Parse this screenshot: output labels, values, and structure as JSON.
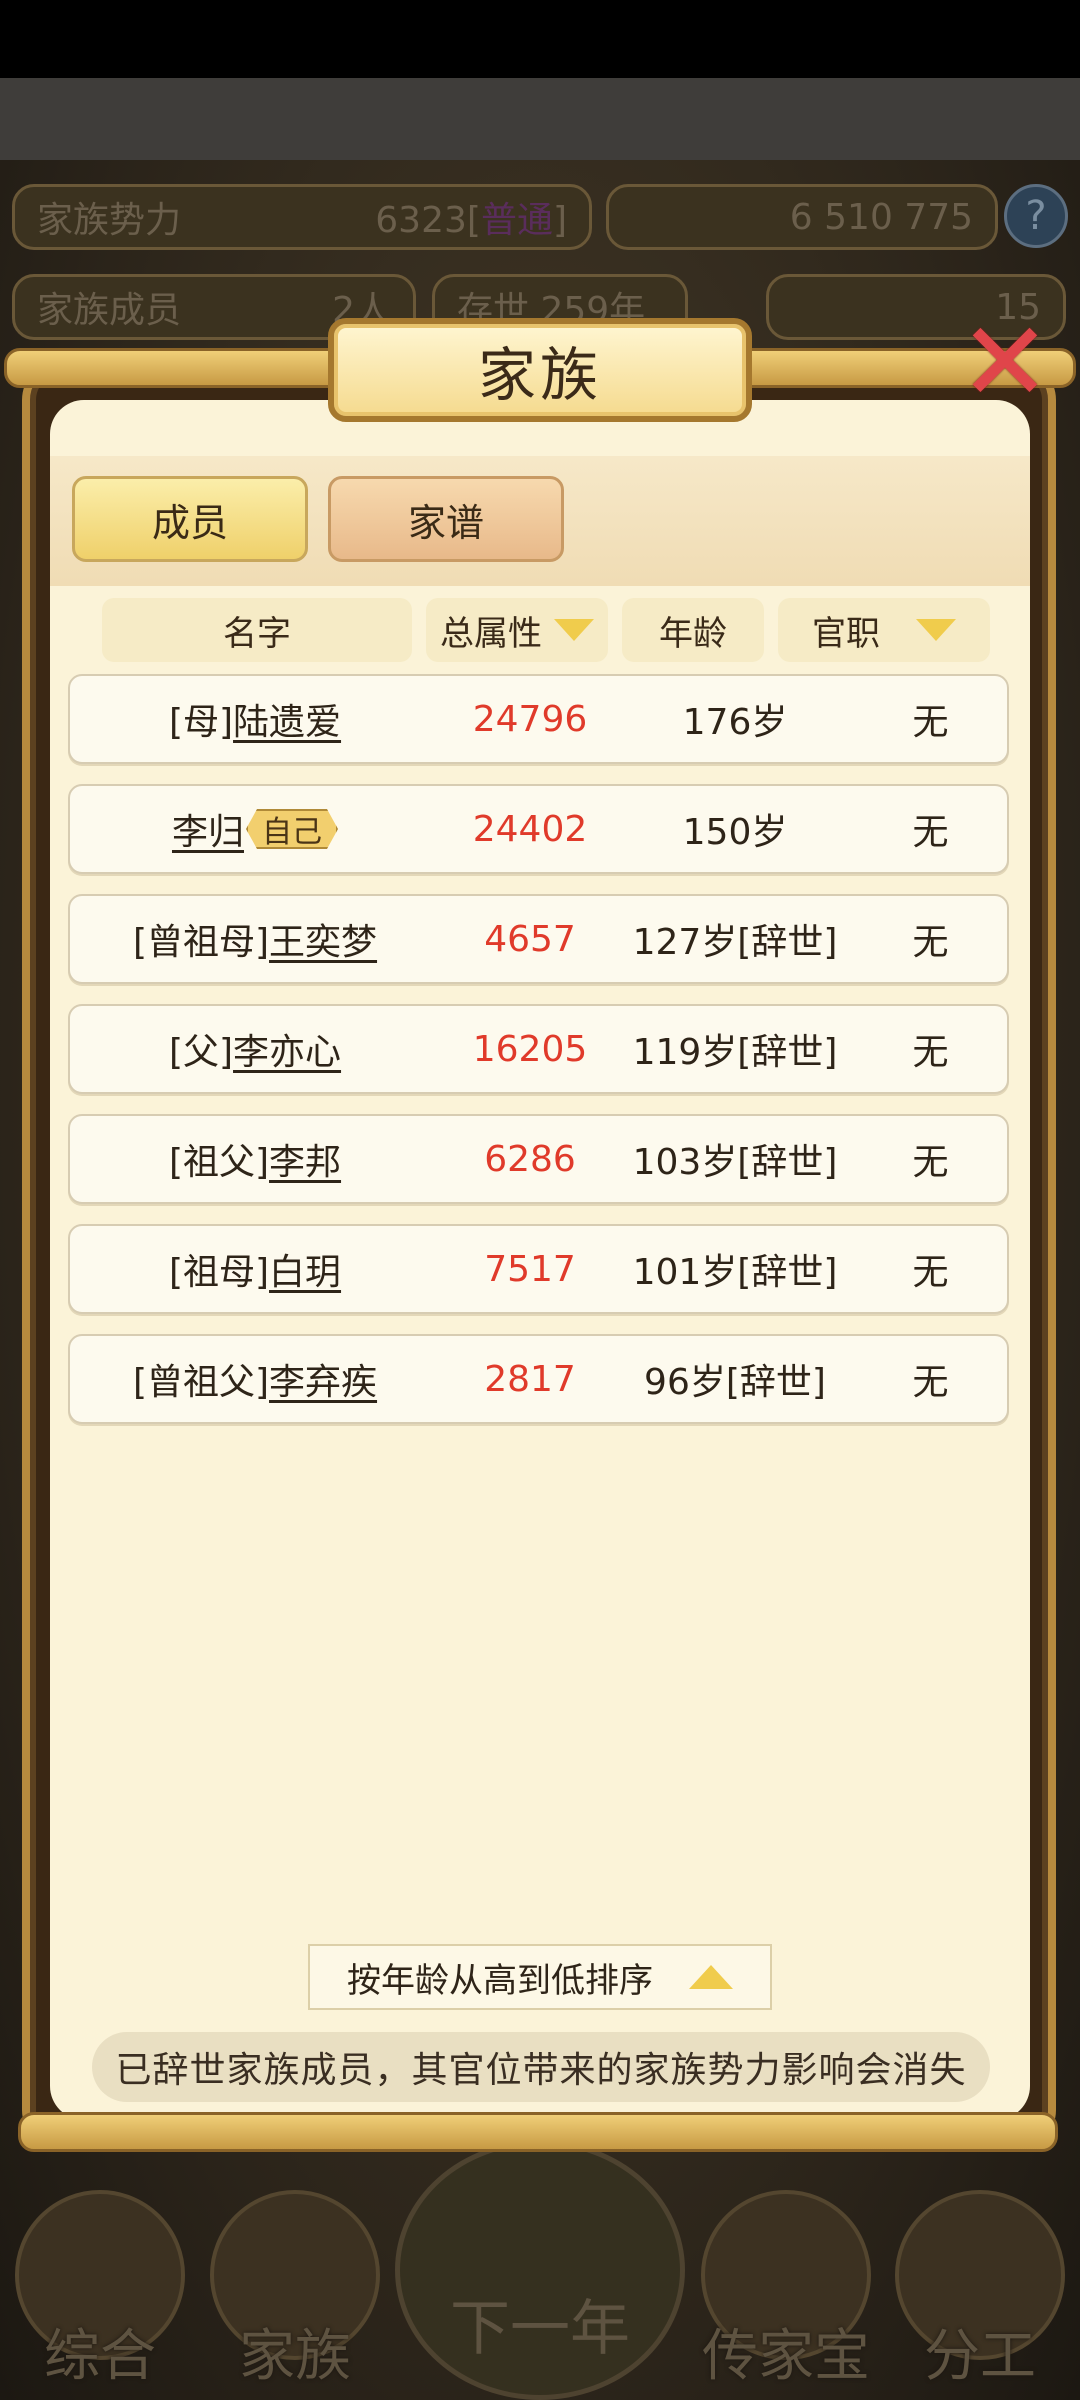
{
  "hud": {
    "power_label": "家族势力",
    "power_value": "6323",
    "power_rank_open": "[",
    "power_rank": "普通",
    "power_rank_close": "]",
    "resources": "6 510 775",
    "members_label": "家族成员",
    "members_value": "2人",
    "existence": "存世 259年",
    "gold_value": "15",
    "help": "?"
  },
  "dialog": {
    "title": "家族",
    "close": "✕",
    "tabs": [
      {
        "label": "成员",
        "active": true
      },
      {
        "label": "家谱",
        "active": false
      }
    ],
    "columns": {
      "name": "名字",
      "attr": "总属性",
      "age": "年龄",
      "job": "官职"
    },
    "rows": [
      {
        "prefix": "[母]",
        "name": "陆遗爱",
        "badge": "",
        "attr": "24796",
        "age": "176岁",
        "job": "无"
      },
      {
        "prefix": "",
        "name": "李归",
        "badge": "自己",
        "attr": "24402",
        "age": "150岁",
        "job": "无"
      },
      {
        "prefix": "[曾祖母]",
        "name": "王奕梦",
        "badge": "",
        "attr": "4657",
        "age": "127岁[辞世]",
        "job": "无"
      },
      {
        "prefix": "[父]",
        "name": "李亦心",
        "badge": "",
        "attr": "16205",
        "age": "119岁[辞世]",
        "job": "无"
      },
      {
        "prefix": "[祖父]",
        "name": "李邦",
        "badge": "",
        "attr": "6286",
        "age": "103岁[辞世]",
        "job": "无"
      },
      {
        "prefix": "[祖母]",
        "name": "白玥",
        "badge": "",
        "attr": "7517",
        "age": "101岁[辞世]",
        "job": "无"
      },
      {
        "prefix": "[曾祖父]",
        "name": "李弃疾",
        "badge": "",
        "attr": "2817",
        "age": "96岁[辞世]",
        "job": "无"
      }
    ],
    "sort_label": "按年龄从高到低排序",
    "notice": "已辞世家族成员，其官位带来的家族势力影响会消失"
  },
  "bottom_nav": {
    "items": [
      "综合",
      "家族",
      "下一年",
      "传家宝",
      "分工"
    ]
  }
}
